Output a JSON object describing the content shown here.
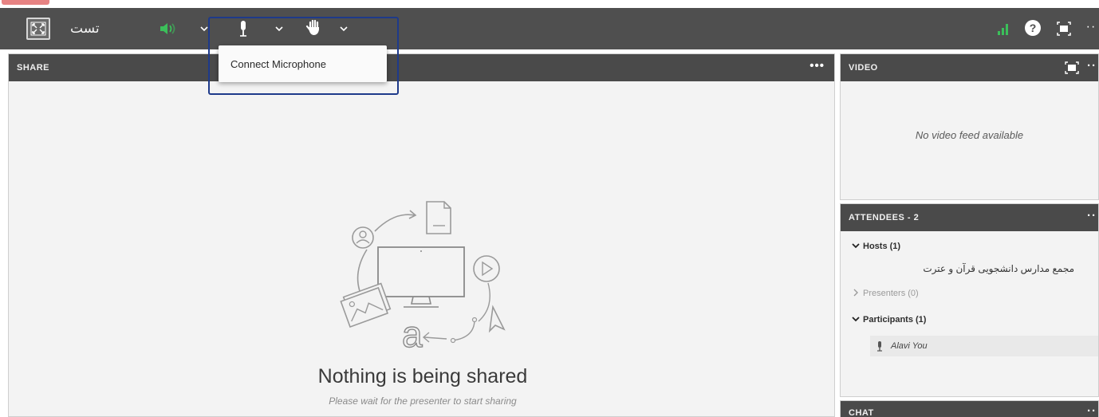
{
  "toolbar": {
    "room_name": "تست",
    "fullscreen_icon": "fullscreen-icon",
    "speaker_icon": "speaker-icon",
    "mic_icon": "microphone-icon",
    "hand_icon": "raise-hand-icon",
    "signal_icon": "signal-strength-icon",
    "help_label": "?",
    "more_label": "··"
  },
  "mic_dropdown": {
    "option_label": "Connect Microphone"
  },
  "share_panel": {
    "title": "SHARE",
    "more_label": "•••",
    "empty_title": "Nothing is being shared",
    "empty_subtitle": "Please wait for the presenter to start sharing"
  },
  "video_panel": {
    "title": "VIDEO",
    "more_label": "··",
    "empty_text": "No video feed available"
  },
  "attendees_panel": {
    "title": "ATTENDEES - 2",
    "more_label": "··",
    "hosts_label": "Hosts (1)",
    "host_name": "مجمع مدارس دانشجویی قرآن و عترت",
    "presenters_label": "Presenters (0)",
    "participants_label": "Participants (1)",
    "participant_name": "Alavi You"
  },
  "chat_panel": {
    "title": "CHAT",
    "more_label": "··"
  },
  "colors": {
    "toolbar_bg": "#4f4f4f",
    "panel_header_bg": "#4a4a4a",
    "speaker_green": "#3bbf5a",
    "signal_green": "#3bbf5a",
    "highlight_border": "#1e3a8a"
  }
}
